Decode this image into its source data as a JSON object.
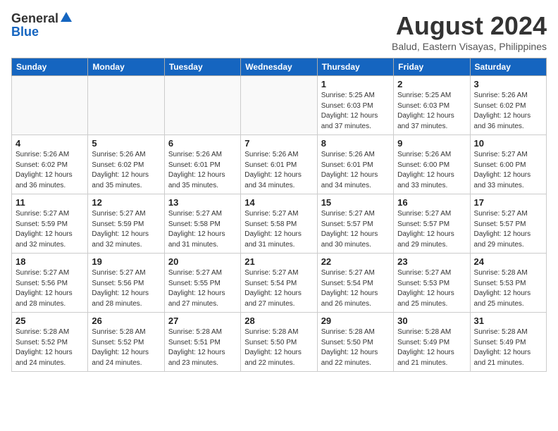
{
  "header": {
    "logo_general": "General",
    "logo_blue": "Blue",
    "title": "August 2024",
    "subtitle": "Balud, Eastern Visayas, Philippines"
  },
  "days_of_week": [
    "Sunday",
    "Monday",
    "Tuesday",
    "Wednesday",
    "Thursday",
    "Friday",
    "Saturday"
  ],
  "weeks": [
    [
      {
        "day": "",
        "sunrise": "",
        "sunset": "",
        "daylight": ""
      },
      {
        "day": "",
        "sunrise": "",
        "sunset": "",
        "daylight": ""
      },
      {
        "day": "",
        "sunrise": "",
        "sunset": "",
        "daylight": ""
      },
      {
        "day": "",
        "sunrise": "",
        "sunset": "",
        "daylight": ""
      },
      {
        "day": "1",
        "sunrise": "5:25 AM",
        "sunset": "6:03 PM",
        "daylight": "12 hours and 37 minutes."
      },
      {
        "day": "2",
        "sunrise": "5:25 AM",
        "sunset": "6:03 PM",
        "daylight": "12 hours and 37 minutes."
      },
      {
        "day": "3",
        "sunrise": "5:26 AM",
        "sunset": "6:02 PM",
        "daylight": "12 hours and 36 minutes."
      }
    ],
    [
      {
        "day": "4",
        "sunrise": "5:26 AM",
        "sunset": "6:02 PM",
        "daylight": "12 hours and 36 minutes."
      },
      {
        "day": "5",
        "sunrise": "5:26 AM",
        "sunset": "6:02 PM",
        "daylight": "12 hours and 35 minutes."
      },
      {
        "day": "6",
        "sunrise": "5:26 AM",
        "sunset": "6:01 PM",
        "daylight": "12 hours and 35 minutes."
      },
      {
        "day": "7",
        "sunrise": "5:26 AM",
        "sunset": "6:01 PM",
        "daylight": "12 hours and 34 minutes."
      },
      {
        "day": "8",
        "sunrise": "5:26 AM",
        "sunset": "6:01 PM",
        "daylight": "12 hours and 34 minutes."
      },
      {
        "day": "9",
        "sunrise": "5:26 AM",
        "sunset": "6:00 PM",
        "daylight": "12 hours and 33 minutes."
      },
      {
        "day": "10",
        "sunrise": "5:27 AM",
        "sunset": "6:00 PM",
        "daylight": "12 hours and 33 minutes."
      }
    ],
    [
      {
        "day": "11",
        "sunrise": "5:27 AM",
        "sunset": "5:59 PM",
        "daylight": "12 hours and 32 minutes."
      },
      {
        "day": "12",
        "sunrise": "5:27 AM",
        "sunset": "5:59 PM",
        "daylight": "12 hours and 32 minutes."
      },
      {
        "day": "13",
        "sunrise": "5:27 AM",
        "sunset": "5:58 PM",
        "daylight": "12 hours and 31 minutes."
      },
      {
        "day": "14",
        "sunrise": "5:27 AM",
        "sunset": "5:58 PM",
        "daylight": "12 hours and 31 minutes."
      },
      {
        "day": "15",
        "sunrise": "5:27 AM",
        "sunset": "5:57 PM",
        "daylight": "12 hours and 30 minutes."
      },
      {
        "day": "16",
        "sunrise": "5:27 AM",
        "sunset": "5:57 PM",
        "daylight": "12 hours and 29 minutes."
      },
      {
        "day": "17",
        "sunrise": "5:27 AM",
        "sunset": "5:57 PM",
        "daylight": "12 hours and 29 minutes."
      }
    ],
    [
      {
        "day": "18",
        "sunrise": "5:27 AM",
        "sunset": "5:56 PM",
        "daylight": "12 hours and 28 minutes."
      },
      {
        "day": "19",
        "sunrise": "5:27 AM",
        "sunset": "5:56 PM",
        "daylight": "12 hours and 28 minutes."
      },
      {
        "day": "20",
        "sunrise": "5:27 AM",
        "sunset": "5:55 PM",
        "daylight": "12 hours and 27 minutes."
      },
      {
        "day": "21",
        "sunrise": "5:27 AM",
        "sunset": "5:54 PM",
        "daylight": "12 hours and 27 minutes."
      },
      {
        "day": "22",
        "sunrise": "5:27 AM",
        "sunset": "5:54 PM",
        "daylight": "12 hours and 26 minutes."
      },
      {
        "day": "23",
        "sunrise": "5:27 AM",
        "sunset": "5:53 PM",
        "daylight": "12 hours and 25 minutes."
      },
      {
        "day": "24",
        "sunrise": "5:28 AM",
        "sunset": "5:53 PM",
        "daylight": "12 hours and 25 minutes."
      }
    ],
    [
      {
        "day": "25",
        "sunrise": "5:28 AM",
        "sunset": "5:52 PM",
        "daylight": "12 hours and 24 minutes."
      },
      {
        "day": "26",
        "sunrise": "5:28 AM",
        "sunset": "5:52 PM",
        "daylight": "12 hours and 24 minutes."
      },
      {
        "day": "27",
        "sunrise": "5:28 AM",
        "sunset": "5:51 PM",
        "daylight": "12 hours and 23 minutes."
      },
      {
        "day": "28",
        "sunrise": "5:28 AM",
        "sunset": "5:50 PM",
        "daylight": "12 hours and 22 minutes."
      },
      {
        "day": "29",
        "sunrise": "5:28 AM",
        "sunset": "5:50 PM",
        "daylight": "12 hours and 22 minutes."
      },
      {
        "day": "30",
        "sunrise": "5:28 AM",
        "sunset": "5:49 PM",
        "daylight": "12 hours and 21 minutes."
      },
      {
        "day": "31",
        "sunrise": "5:28 AM",
        "sunset": "5:49 PM",
        "daylight": "12 hours and 21 minutes."
      }
    ]
  ],
  "labels": {
    "sunrise": "Sunrise:",
    "sunset": "Sunset:",
    "daylight": "Daylight:"
  }
}
